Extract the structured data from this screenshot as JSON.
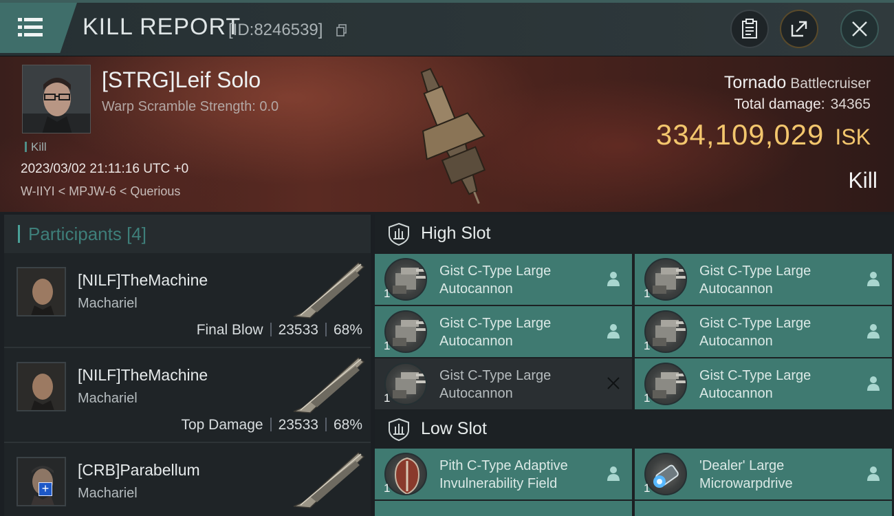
{
  "header": {
    "title": "KILL REPORT",
    "report_id": "[ID:8246539]",
    "icons": [
      "menu-icon",
      "copy-icon",
      "clipboard-icon",
      "share-icon",
      "close-icon"
    ]
  },
  "victim": {
    "name": "[STRG]Leif Solo",
    "warp_scramble": "Warp Scramble Strength: 0.0",
    "tag": "Kill",
    "timestamp": "2023/03/02 21:11:16 UTC +0",
    "location": "W-IIYI < MPJW-6 < Querious",
    "ship_name": "Tornado",
    "ship_class": "Battlecruiser",
    "total_damage_label": "Total damage:",
    "total_damage": "34365",
    "isk_value": "334,109,029",
    "isk_unit": "ISK",
    "result": "Kill"
  },
  "participants": {
    "title": "Participants",
    "count": "[4]",
    "list": [
      {
        "name": "[NILF]TheMachine",
        "ship": "Machariel",
        "role": "Final Blow",
        "damage": "23533",
        "percent": "68%"
      },
      {
        "name": "[NILF]TheMachine",
        "ship": "Machariel",
        "role": "Top Damage",
        "damage": "23533",
        "percent": "68%"
      },
      {
        "name": "[CRB]Parabellum",
        "ship": "Machariel",
        "role": "",
        "damage": "",
        "percent": ""
      }
    ]
  },
  "slots": {
    "high": {
      "label": "High Slot",
      "modules": [
        {
          "name": "Gist C-Type Large Autocannon",
          "qty": "1",
          "status": "dropped"
        },
        {
          "name": "Gist C-Type Large Autocannon",
          "qty": "1",
          "status": "dropped"
        },
        {
          "name": "Gist C-Type Large Autocannon",
          "qty": "1",
          "status": "dropped"
        },
        {
          "name": "Gist C-Type Large Autocannon",
          "qty": "1",
          "status": "dropped"
        },
        {
          "name": "Gist C-Type Large Autocannon",
          "qty": "1",
          "status": "destroyed"
        },
        {
          "name": "Gist C-Type Large Autocannon",
          "qty": "1",
          "status": "dropped"
        }
      ]
    },
    "low": {
      "label": "Low Slot",
      "modules": [
        {
          "name": "Pith C-Type Adaptive Invulnerability Field",
          "qty": "1",
          "status": "dropped"
        },
        {
          "name": "'Dealer' Large Microwarpdrive",
          "qty": "1",
          "status": "dropped"
        }
      ]
    }
  },
  "colors": {
    "accent": "#3f7a71",
    "isk": "#f3c66d",
    "destroyed": "#2a2f32"
  }
}
